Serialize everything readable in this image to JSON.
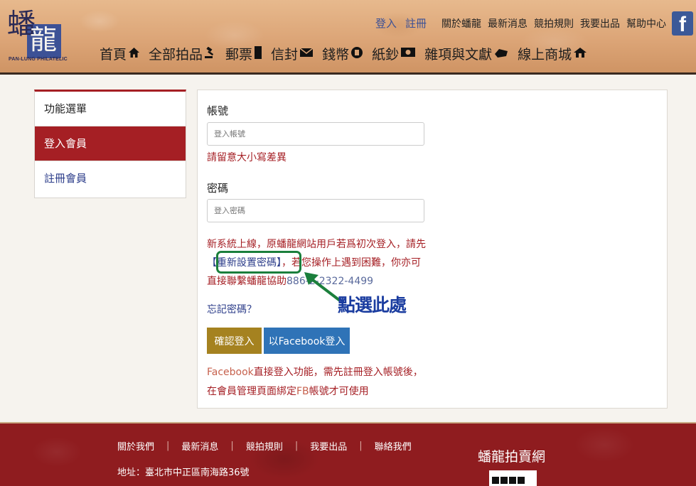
{
  "header": {
    "logo_char1": "蟠",
    "logo_char2": "龍",
    "logo_en": "PAN-LUNG PHILATELIC",
    "login": "登入",
    "register": "註冊",
    "links": [
      "關於蟠龍",
      "最新消息",
      "競拍規則",
      "我要出品",
      "幫助中心"
    ],
    "fb_icon": "facebook-icon",
    "nav": [
      {
        "label": "首頁",
        "icon": "home-icon",
        "glyph": "🏠"
      },
      {
        "label": "全部拍品",
        "icon": "gavel-icon",
        "glyph": "⚖"
      },
      {
        "label": "郵票",
        "icon": "stamp-icon",
        "glyph": "▮"
      },
      {
        "label": "信封",
        "icon": "envelope-icon",
        "glyph": "✉"
      },
      {
        "label": "錢幣",
        "icon": "coin-icon",
        "glyph": "◉"
      },
      {
        "label": "紙鈔",
        "icon": "banknote-icon",
        "glyph": "▣"
      },
      {
        "label": "雜項與文獻",
        "icon": "misc-icon",
        "glyph": "◆"
      },
      {
        "label": "線上商城",
        "icon": "store-icon",
        "glyph": "⌂"
      }
    ]
  },
  "sidebar": {
    "title": "功能選單",
    "items": [
      "登入會員",
      "註冊會員"
    ]
  },
  "login": {
    "account_label": "帳號",
    "account_placeholder": "登入帳號",
    "case_hint": "請留意大小寫差異",
    "password_label": "密碼",
    "password_placeholder": "登入密碼",
    "notice_1": "新系統上線，原蟠龍網站用戶若爲初次登入，請先",
    "reset_link": "【重新設置密碼】",
    "notice_2": "，若您操作上遇到困難，你亦可直接聯繫蟠龍協助",
    "phone": "886-2-2322-4499",
    "annotation": "點選此處",
    "forgot": "忘記密碼？",
    "confirm_btn": "確認登入",
    "fb_btn": "以Facebook登入",
    "fb_note_word": "Facebook",
    "fb_note_1": "直接登入功能，需先註冊登入帳號後，",
    "fb_note_2": "在會員管理頁面綁定",
    "fb_note_fb": "FB",
    "fb_note_3": "帳號才可使用"
  },
  "footer": {
    "links": [
      "關於我們",
      "最新消息",
      "競拍規則",
      "我要出品",
      "聯絡我們"
    ],
    "address": "地址：臺北市中正區南海路36號",
    "brand": "蟠龍拍賣網"
  },
  "colors": {
    "accent_red": "#a51f24",
    "link_blue": "#2c3d8a",
    "annotation_green": "#1b7f3c",
    "annotation_blue": "#1b3da0",
    "confirm_gold": "#a58220",
    "facebook_blue": "#2f73b7"
  }
}
